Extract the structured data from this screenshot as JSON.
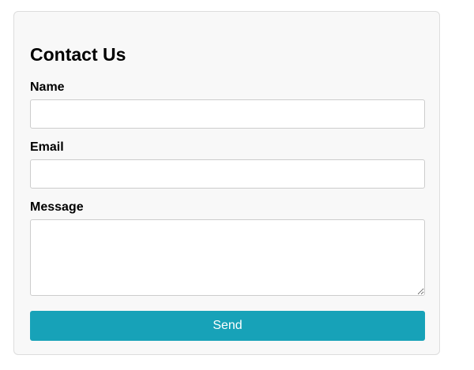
{
  "form": {
    "title": "Contact Us",
    "name_label": "Name",
    "name_value": "",
    "email_label": "Email",
    "email_value": "",
    "message_label": "Message",
    "message_value": "",
    "send_label": "Send"
  },
  "colors": {
    "accent": "#17a2b8",
    "card_background": "#f8f8f8",
    "input_border": "#cccccc"
  }
}
